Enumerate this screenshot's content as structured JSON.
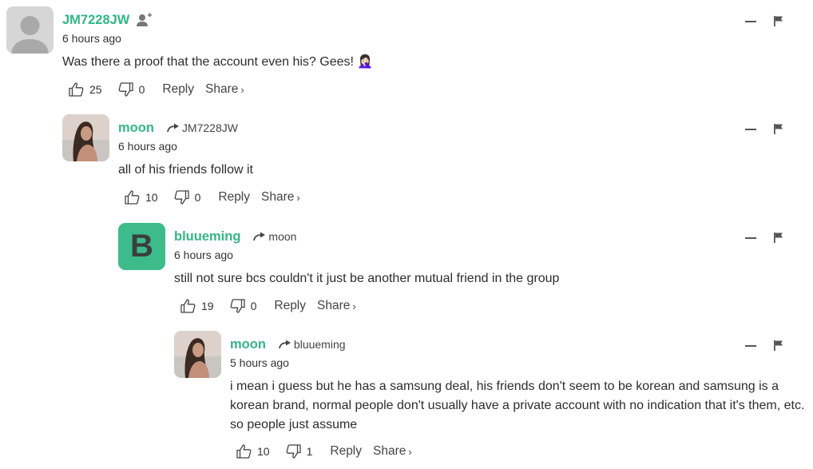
{
  "comments": [
    {
      "username": "JM7228JW",
      "reply_to": "",
      "time": "6 hours ago",
      "text": "Was there a proof that the account even his? Gees! 🤦🏻‍♀️",
      "likes": "25",
      "dislikes": "0",
      "reply_label": "Reply",
      "share_label": "Share",
      "avatar": "default"
    },
    {
      "username": "moon",
      "reply_to": "JM7228JW",
      "time": "6 hours ago",
      "text": "all of his friends follow it",
      "likes": "10",
      "dislikes": "0",
      "reply_label": "Reply",
      "share_label": "Share",
      "avatar": "photo"
    },
    {
      "username": "bluueming",
      "reply_to": "moon",
      "time": "6 hours ago",
      "text": "still not sure bcs couldn't it just be another mutual friend in the group",
      "likes": "19",
      "dislikes": "0",
      "reply_label": "Reply",
      "share_label": "Share",
      "avatar": "letter",
      "avatar_letter": "B"
    },
    {
      "username": "moon",
      "reply_to": "bluueming",
      "time": "5 hours ago",
      "text": "i mean i guess but he has a samsung deal, his friends don't seem to be korean and samsung is a korean brand, normal people don't usually have a private account with no indication that it's them, etc. so people just assume",
      "likes": "10",
      "dislikes": "1",
      "reply_label": "Reply",
      "share_label": "Share",
      "avatar": "photo"
    }
  ],
  "colors": {
    "username": "#32b686",
    "letter_avatar": "#3dbb8a"
  },
  "icons": [
    "add-user-icon",
    "reply-arrow-icon",
    "minus-icon",
    "flag-icon",
    "thumbs-up-icon",
    "thumbs-down-icon",
    "chevron-right-icon"
  ]
}
